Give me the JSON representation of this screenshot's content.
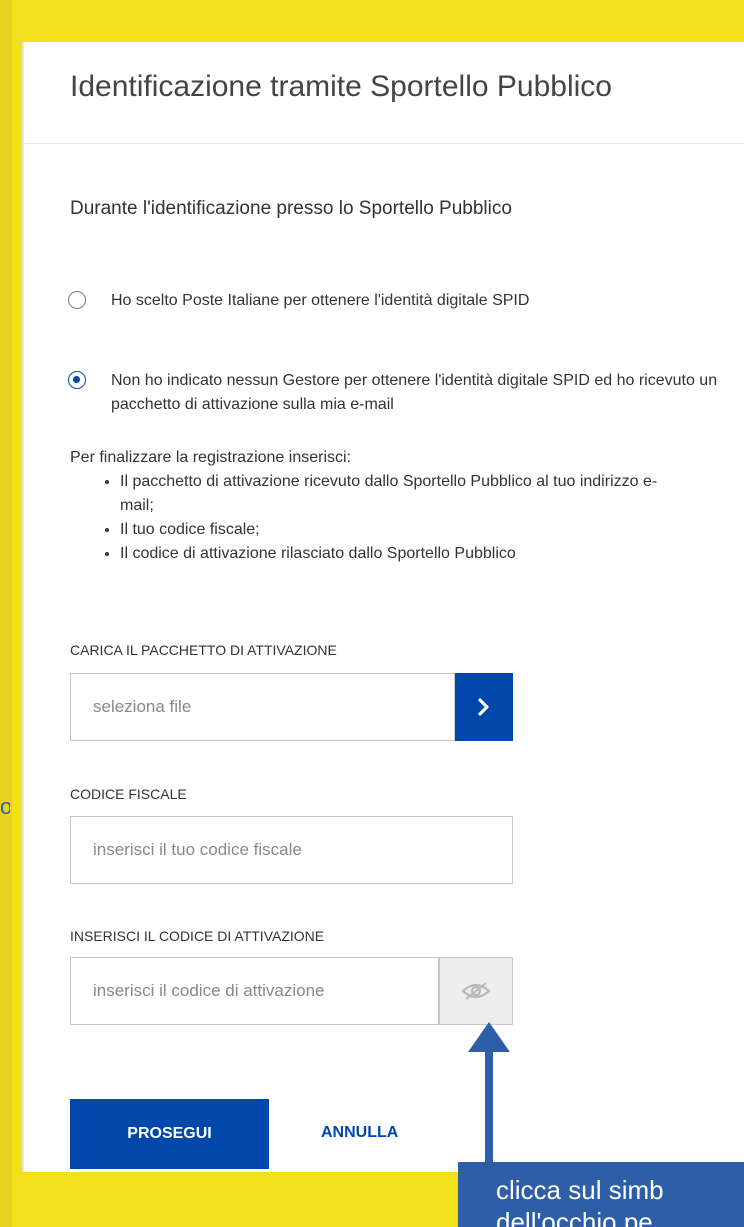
{
  "header": {
    "title": "Identificazione tramite Sportello Pubblico"
  },
  "intro": {
    "subtitle": "Durante l'identificazione presso lo Sportello Pubblico"
  },
  "options": [
    {
      "label": "Ho scelto Poste Italiane per ottenere l'identità digitale SPID",
      "selected": false
    },
    {
      "label": "Non ho indicato nessun Gestore per ottenere l'identità digitale SPID ed ho ricevuto un pacchetto di attivazione sulla mia e-mail",
      "selected": true
    }
  ],
  "instructions": {
    "intro": "Per finalizzare la registrazione inserisci:",
    "items": [
      "Il pacchetto di attivazione ricevuto dallo Sportello Pubblico al tuo indirizzo e-mail;",
      "Il tuo codice fiscale;",
      "Il codice di attivazione rilasciato dallo Sportello Pubblico"
    ]
  },
  "fields": {
    "package": {
      "label": "CARICA IL PACCHETTO DI ATTIVAZIONE",
      "placeholder": "seleziona file",
      "value": ""
    },
    "fiscal_code": {
      "label": "CODICE FISCALE",
      "placeholder": "inserisci il tuo codice fiscale",
      "value": ""
    },
    "activation_code": {
      "label": "INSERISCI IL CODICE DI ATTIVAZIONE",
      "placeholder": "inserisci il codice di attivazione",
      "value": ""
    }
  },
  "actions": {
    "primary": "PROSEGUI",
    "secondary": "ANNULLA"
  },
  "callout": {
    "line1": "clicca sul simb",
    "line2": "dell'occhio pe"
  },
  "icons": {
    "go": "chevron-right-icon",
    "eye": "eye-slash-icon",
    "pointer": "arrow-up-icon"
  },
  "colors": {
    "accent": "#0047ab",
    "background": "#f2e01b",
    "callout": "#2f5ea8"
  }
}
